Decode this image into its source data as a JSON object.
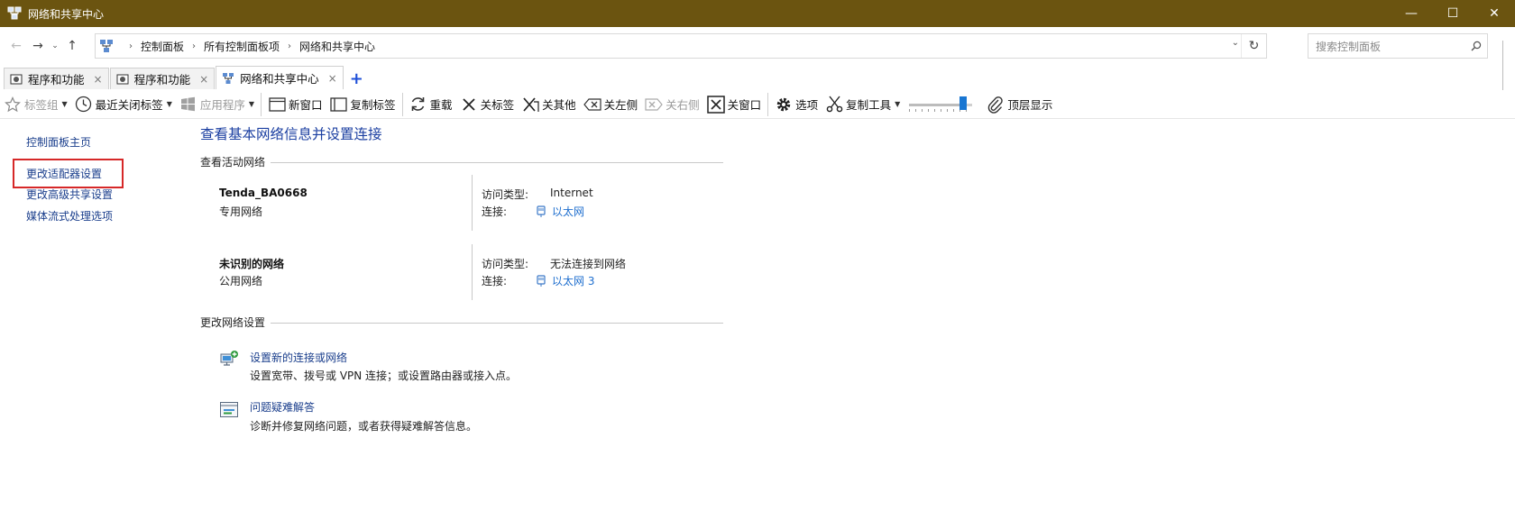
{
  "window": {
    "title": "网络和共享中心",
    "minimize": "—",
    "maximize": "☐",
    "close": "✕"
  },
  "address": {
    "crumbs": [
      "控制面板",
      "所有控制面板项",
      "网络和共享中心"
    ],
    "search_placeholder": "搜索控制面板"
  },
  "tabs": [
    {
      "label": "程序和功能",
      "close": "×"
    },
    {
      "label": "程序和功能",
      "close": "×"
    },
    {
      "label": "网络和共享中心",
      "close": "×"
    },
    {
      "label": "+"
    }
  ],
  "toolbar": {
    "tag_group": "标签组",
    "recent_closed": "最近关闭标签",
    "apps": "应用程序",
    "new_window": "新窗口",
    "copy_tab": "复制标签",
    "reload": "重载",
    "close_tab": "关标签",
    "close_others": "关其他",
    "close_left": "关左侧",
    "close_right": "关右侧",
    "close_window": "关窗口",
    "options": "选项",
    "copy_tool": "复制工具",
    "topmost": "顶层显示",
    "opacity_level": 0.9
  },
  "left_pane": {
    "links": [
      "控制面板主页",
      "更改适配器设置",
      "更改高级共享设置",
      "媒体流式处理选项"
    ]
  },
  "main": {
    "heading": "查看基本网络信息并设置连接",
    "active_networks_title": "查看活动网络",
    "networks": [
      {
        "name": "Tenda_BA0668",
        "type": "专用网络",
        "access_label": "访问类型:",
        "access_value": "Internet",
        "conn_label": "连接:",
        "conn_value": "以太网"
      },
      {
        "name": "未识别的网络",
        "type": "公用网络",
        "access_label": "访问类型:",
        "access_value": "无法连接到网络",
        "conn_label": "连接:",
        "conn_value": "以太网 3"
      }
    ],
    "change_settings_title": "更改网络设置",
    "tasks": [
      {
        "link": "设置新的连接或网络",
        "desc": "设置宽带、拨号或 VPN 连接；或设置路由器或接入点。"
      },
      {
        "link": "问题疑难解答",
        "desc": "诊断并修复网络问题，或者获得疑难解答信息。"
      }
    ]
  }
}
